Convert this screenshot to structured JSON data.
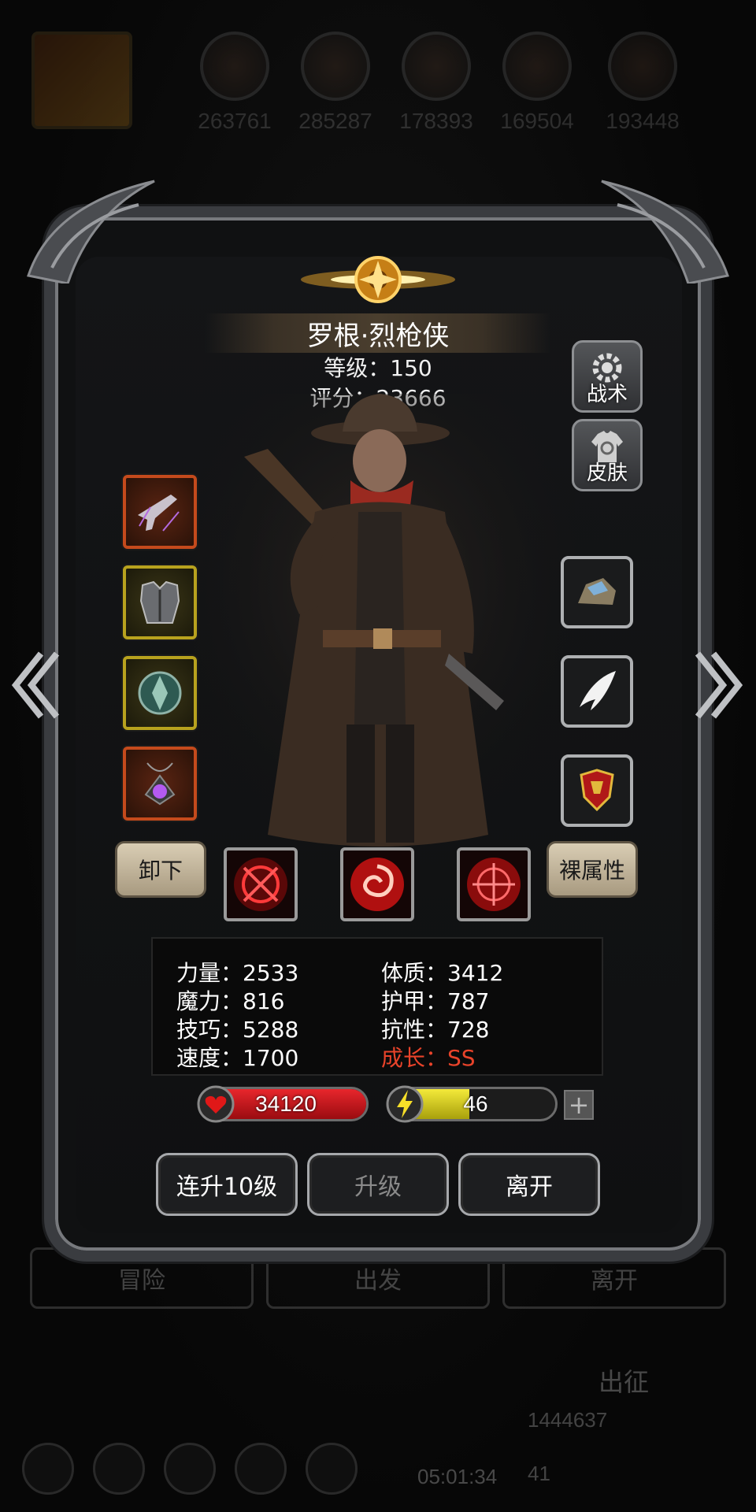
{
  "background": {
    "hero_scores": [
      "263761",
      "285287",
      "178393",
      "169504",
      "193448"
    ],
    "buttons": [
      "冒险",
      "出发",
      "离开"
    ],
    "sortie_label": "出征",
    "resources": [
      "1444637",
      "41"
    ],
    "timer": "05:01:34"
  },
  "hero": {
    "name": "罗根·烈枪侠",
    "level_text": "等级：150",
    "score_text": "评分：23666"
  },
  "side_buttons": {
    "tactics": "战术",
    "skin": "皮肤"
  },
  "equipment_left": [
    {
      "name": "pistol-icon",
      "rarity": "red"
    },
    {
      "name": "armor-icon",
      "rarity": "gold"
    },
    {
      "name": "shield-icon",
      "rarity": "gold"
    },
    {
      "name": "amulet-icon",
      "rarity": "red"
    }
  ],
  "equipment_right": [
    {
      "name": "ore-icon"
    },
    {
      "name": "wing-icon"
    },
    {
      "name": "crest-icon"
    }
  ],
  "controls": {
    "unequip": "卸下",
    "bare_attributes": "裸属性"
  },
  "stats": {
    "strength": "力量：2533",
    "magic": "魔力：816",
    "skill": "技巧：5288",
    "speed": "速度：1700",
    "constitution": "体质：3412",
    "armor": "护甲：787",
    "resistance": "抗性：728",
    "growth": "成长：SS"
  },
  "bars": {
    "hp": "34120",
    "hp_fill": 1.0,
    "energy": "46",
    "energy_fill": 0.46
  },
  "plus_label": "+",
  "actions": {
    "level_up_10": "连升10级",
    "level_up": "升级",
    "leave": "离开"
  },
  "colors": {
    "hp": "#c8141c",
    "energy": "#d8cf1a",
    "growth": "#e8432a"
  }
}
